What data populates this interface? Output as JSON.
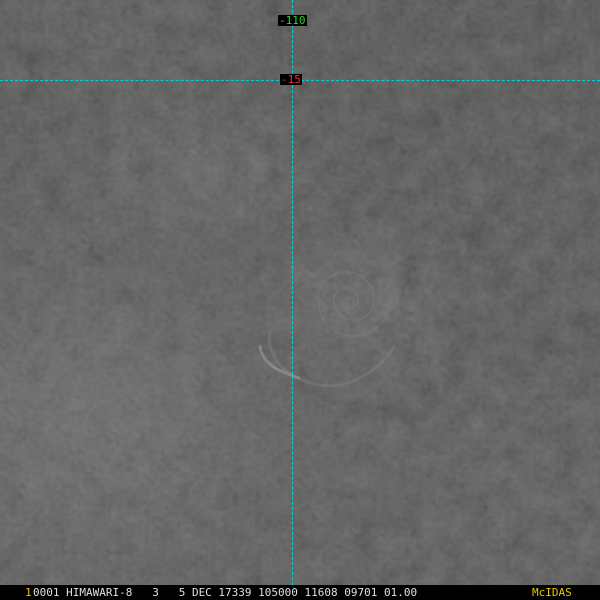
{
  "overlay": {
    "longitude_label": "-110",
    "latitude_label": "-15",
    "grid_color": "#00d5d5",
    "longitude_label_color": "#22dd22",
    "latitude_label_color": "#ff2a2a"
  },
  "info_bar": {
    "frame_number": "1",
    "text": "0001 HIMAWARI-8   3   5 DEC 17339 105000 11608 09701 01.00",
    "brand": "McIDAS",
    "frame_number_color": "#e8c800",
    "text_color": "#e0e0e0",
    "brand_color": "#e8c800"
  }
}
